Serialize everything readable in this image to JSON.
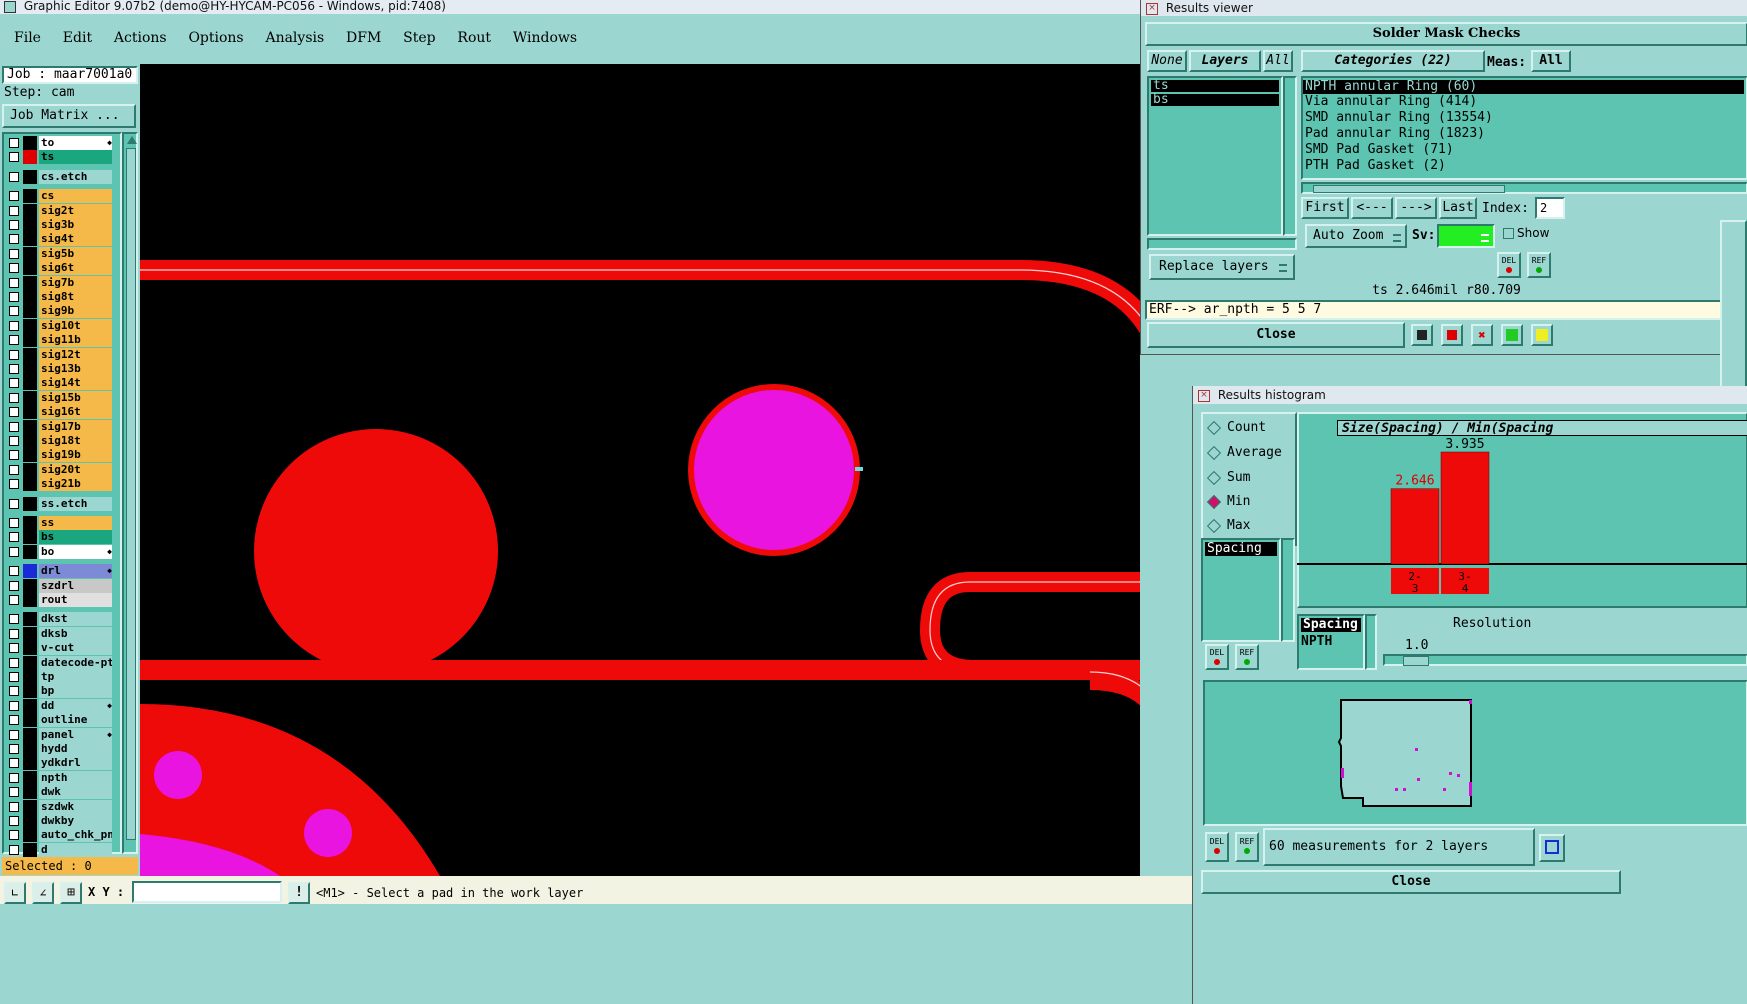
{
  "main_window": {
    "title": "Graphic Editor 9.07b2 (demo@HY-HYCAM-PC056 - Windows, pid:7408)",
    "menu": [
      "File",
      "Edit",
      "Actions",
      "Options",
      "Analysis",
      "DFM",
      "Step",
      "Rout",
      "Windows"
    ]
  },
  "left_panel": {
    "job": "Job : maar7001a0",
    "step": "Step: cam",
    "job_matrix": "Job Matrix ...",
    "layers": [
      {
        "name": "to",
        "color": "#ffffff",
        "swatch": "#000000",
        "extra": true
      },
      {
        "name": "ts",
        "color": "#1aa67e",
        "swatch": "#e00000"
      },
      {
        "name": "cs.etch",
        "color": "#9bd6d0",
        "swatch": "#000000",
        "gap": true
      },
      {
        "name": "cs",
        "color": "#f5b94a",
        "swatch": "#000000",
        "gap": true
      },
      {
        "name": "sig2t",
        "color": "#f5b94a",
        "swatch": "#000000"
      },
      {
        "name": "sig3b",
        "color": "#f5b94a",
        "swatch": "#000000"
      },
      {
        "name": "sig4t",
        "color": "#f5b94a",
        "swatch": "#000000"
      },
      {
        "name": "sig5b",
        "color": "#f5b94a",
        "swatch": "#000000"
      },
      {
        "name": "sig6t",
        "color": "#f5b94a",
        "swatch": "#000000"
      },
      {
        "name": "sig7b",
        "color": "#f5b94a",
        "swatch": "#000000"
      },
      {
        "name": "sig8t",
        "color": "#f5b94a",
        "swatch": "#000000"
      },
      {
        "name": "sig9b",
        "color": "#f5b94a",
        "swatch": "#000000"
      },
      {
        "name": "sig10t",
        "color": "#f5b94a",
        "swatch": "#000000"
      },
      {
        "name": "sig11b",
        "color": "#f5b94a",
        "swatch": "#000000"
      },
      {
        "name": "sig12t",
        "color": "#f5b94a",
        "swatch": "#000000"
      },
      {
        "name": "sig13b",
        "color": "#f5b94a",
        "swatch": "#000000"
      },
      {
        "name": "sig14t",
        "color": "#f5b94a",
        "swatch": "#000000"
      },
      {
        "name": "sig15b",
        "color": "#f5b94a",
        "swatch": "#000000"
      },
      {
        "name": "sig16t",
        "color": "#f5b94a",
        "swatch": "#000000"
      },
      {
        "name": "sig17b",
        "color": "#f5b94a",
        "swatch": "#000000"
      },
      {
        "name": "sig18t",
        "color": "#f5b94a",
        "swatch": "#000000"
      },
      {
        "name": "sig19b",
        "color": "#f5b94a",
        "swatch": "#000000"
      },
      {
        "name": "sig20t",
        "color": "#f5b94a",
        "swatch": "#000000"
      },
      {
        "name": "sig21b",
        "color": "#f5b94a",
        "swatch": "#000000"
      },
      {
        "name": "ss.etch",
        "color": "#9bd6d0",
        "swatch": "#000000",
        "gap": true
      },
      {
        "name": "ss",
        "color": "#f5b94a",
        "swatch": "#000000",
        "gap": true
      },
      {
        "name": "bs",
        "color": "#1aa67e",
        "swatch": "#000000"
      },
      {
        "name": "bo",
        "color": "#ffffff",
        "swatch": "#000000",
        "extra": true
      },
      {
        "name": "drl",
        "color": "#7d8bd6",
        "swatch": "#1a2ad6",
        "gap": true,
        "extra": true
      },
      {
        "name": "szdrl",
        "color": "#c8c8c8",
        "swatch": "#000000"
      },
      {
        "name": "rout",
        "color": "#e0e0e0",
        "swatch": "#000000"
      },
      {
        "name": "dkst",
        "color": "#9bd6d0",
        "swatch": "#000000",
        "gap": true
      },
      {
        "name": "dksb",
        "color": "#9bd6d0",
        "swatch": "#000000"
      },
      {
        "name": "v-cut",
        "color": "#9bd6d0",
        "swatch": "#000000"
      },
      {
        "name": "datecode-pte",
        "color": "#9bd6d0",
        "swatch": "#000000"
      },
      {
        "name": "tp",
        "color": "#9bd6d0",
        "swatch": "#000000"
      },
      {
        "name": "bp",
        "color": "#9bd6d0",
        "swatch": "#000000"
      },
      {
        "name": "dd",
        "color": "#9bd6d0",
        "swatch": "#000000",
        "extra": true
      },
      {
        "name": "outline",
        "color": "#9bd6d0",
        "swatch": "#000000"
      },
      {
        "name": "panel",
        "color": "#9bd6d0",
        "swatch": "#000000",
        "extra": true
      },
      {
        "name": "hydd",
        "color": "#9bd6d0",
        "swatch": "#000000"
      },
      {
        "name": "ydkdrl",
        "color": "#9bd6d0",
        "swatch": "#000000"
      },
      {
        "name": "npth",
        "color": "#9bd6d0",
        "swatch": "#000000"
      },
      {
        "name": "dwk",
        "color": "#9bd6d0",
        "swatch": "#000000"
      },
      {
        "name": "szdwk",
        "color": "#9bd6d0",
        "swatch": "#000000"
      },
      {
        "name": "dwkby",
        "color": "#9bd6d0",
        "swatch": "#000000"
      },
      {
        "name": "auto_chk_pnl",
        "color": "#9bd6d0",
        "swatch": "#000000"
      },
      {
        "name": "d",
        "color": "#9bd6d0",
        "swatch": "#000000"
      }
    ],
    "selected": "Selected : 0"
  },
  "status_bar": {
    "xy_label": "X Y :",
    "xy_value": "",
    "message": "<M1> - Select a pad in the work layer"
  },
  "results_viewer": {
    "title": "Results viewer",
    "header": "Solder Mask Checks",
    "none_btn": "None",
    "layers_btn": "Layers",
    "all_btn": "All",
    "layers": [
      "ts",
      "bs"
    ],
    "categories_label": "Categories (22)",
    "meas_label": "Meas:",
    "meas_value": "All",
    "categories": [
      "NPTH annular Ring (60)",
      "Via annular Ring (414)",
      "SMD annular Ring (13554)",
      "Pad annular Ring (1823)",
      "SMD Pad Gasket (71)",
      "PTH Pad Gasket (2)"
    ],
    "first_btn": "First",
    "prev_btn": "<---",
    "next_btn": "--->",
    "last_btn": "Last",
    "index_label": "Index:",
    "index_value": "2",
    "auto_zoom": "Auto Zoom",
    "sv_label": "Sv:",
    "show_label": "Show",
    "replace_layers": "Replace layers",
    "del_label": "DEL",
    "ref_label": "REF",
    "measurement_info": "ts 2.646mil  r80.709",
    "erf_line": "ERF--> ar_npth = 5 5 7",
    "close": "Close"
  },
  "histogram": {
    "title": "Results histogram",
    "options": [
      {
        "label": "Count",
        "selected": false
      },
      {
        "label": "Average",
        "selected": false
      },
      {
        "label": "Sum",
        "selected": false
      },
      {
        "label": "Min",
        "selected": true
      },
      {
        "label": "Max",
        "selected": false
      }
    ],
    "list_item": "Spacing",
    "chart_title": "Size(Spacing) / Min(Spacing",
    "bar1_value": "2.646",
    "bar2_value": "3.935",
    "bar1_label": "2-\n3",
    "bar2_label": "3-\n4",
    "spacing_header": "Spacing",
    "spacing_item": "NPTH",
    "resolution_label": "Resolution",
    "resolution_value": "1.0",
    "del_label": "DEL",
    "ref_label": "REF",
    "summary": "60 measurements for 2 layers",
    "close": "Close"
  },
  "chart_data": {
    "type": "bar",
    "title": "Size(Spacing) / Min(Spacing",
    "categories": [
      "2-3",
      "3-4"
    ],
    "values": [
      2.646,
      3.935
    ]
  }
}
